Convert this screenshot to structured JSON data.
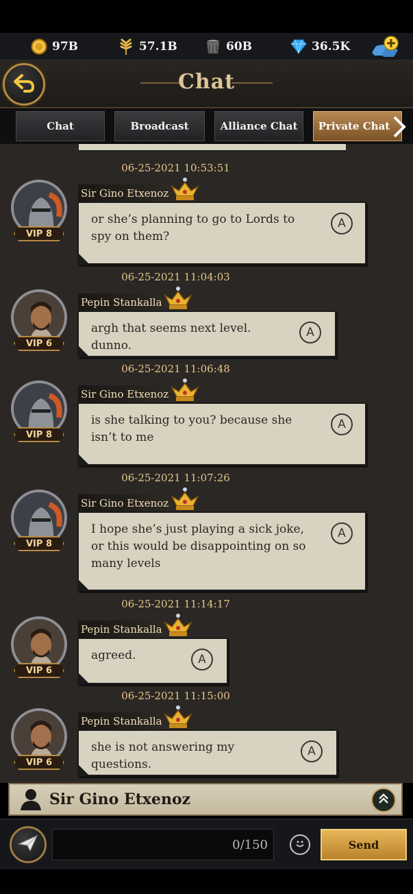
{
  "resources": {
    "gold": "97B",
    "food": "57.1B",
    "iron": "60B",
    "gems": "36.5K"
  },
  "header": {
    "title": "Chat"
  },
  "tabs": [
    {
      "label": "Chat"
    },
    {
      "label": "Broadcast"
    },
    {
      "label": "Alliance Chat"
    },
    {
      "label": "Private Chat",
      "active": true
    }
  ],
  "messages": [
    {
      "timestamp": "06-25-2021 10:53:51",
      "sender": "Sir Gino Etxenoz",
      "vip": "VIP 8",
      "text": "or she’s planning to go to Lords to spy on them?"
    },
    {
      "timestamp": "06-25-2021 11:04:03",
      "sender": "Pepin Stankalla",
      "vip": "VIP 6",
      "text": "argh that seems next level. dunno."
    },
    {
      "timestamp": "06-25-2021 11:06:48",
      "sender": "Sir Gino Etxenoz",
      "vip": "VIP 8",
      "text": "is she talking to you? because she isn’t to me"
    },
    {
      "timestamp": "06-25-2021 11:07:26",
      "sender": "Sir Gino Etxenoz",
      "vip": "VIP 8",
      "text": "I hope she’s just playing a sick joke, or this would be disappointing on so many levels"
    },
    {
      "timestamp": "06-25-2021 11:14:17",
      "sender": "Pepin Stankalla",
      "vip": "VIP 6",
      "text": "agreed."
    },
    {
      "timestamp": "06-25-2021 11:15:00",
      "sender": "Pepin Stankalla",
      "vip": "VIP 6",
      "text": "she is not answering my questions."
    }
  ],
  "recipient": {
    "name": "Sir Gino Etxenoz"
  },
  "composer": {
    "counter": "0/150",
    "send_label": "Send"
  },
  "colors": {
    "accent_gold": "#e4c889",
    "bubble": "#d8d2c0",
    "background": "#2b2724"
  }
}
